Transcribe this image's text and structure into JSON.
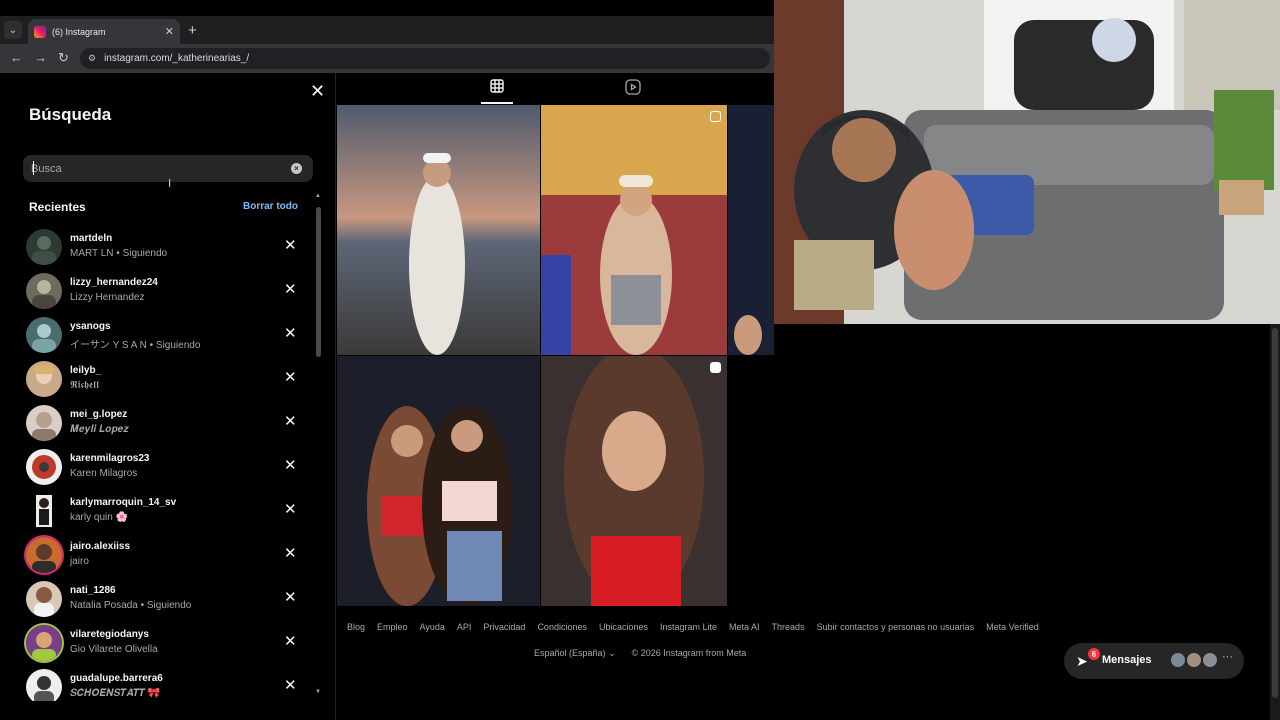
{
  "browser": {
    "tab_title": "(6) Instagram",
    "url": "instagram.com/_katherinearias_/"
  },
  "search_panel": {
    "title": "Búsqueda",
    "placeholder": "Busca",
    "recent_heading": "Recientes",
    "clear_all": "Borrar todo",
    "results": [
      {
        "username": "martdeln",
        "subtitle": "MART LN • Siguiendo"
      },
      {
        "username": "lizzy_hernandez24",
        "subtitle": "Lizzy Hernandez"
      },
      {
        "username": "ysanogs",
        "subtitle": "イーサン Y S A N • Siguiendo"
      },
      {
        "username": "leilyb_",
        "subtitle": "𝕽𝖎𝖈𝖍𝖊𝖑𝖑"
      },
      {
        "username": "mei_g.lopez",
        "subtitle": "𝑴𝒆𝒚𝒍𝒊 𝑳𝒐𝒑𝒆𝒛"
      },
      {
        "username": "karenmilagros23",
        "subtitle": "Karen Milagros"
      },
      {
        "username": "karlymarroquin_14_sv",
        "subtitle": "karly quin 🌸"
      },
      {
        "username": "jairo.alexiiss",
        "subtitle": "jairo"
      },
      {
        "username": "nati_1286",
        "subtitle": "Natalia Posada • Siguiendo"
      },
      {
        "username": "vilaretegiodanys",
        "subtitle": "Gio Vilarete Olivella"
      },
      {
        "username": "guadalupe.barrera6",
        "subtitle": "𝑺𝑪𝑯𝑶𝑬𝑵𝑺𝑻𝑨𝑻𝑻 🎀"
      }
    ]
  },
  "footer": {
    "links": [
      "Blog",
      "Empleo",
      "Ayuda",
      "API",
      "Privacidad",
      "Condiciones",
      "Ubicaciones",
      "Instagram Lite",
      "Meta AI",
      "Threads",
      "Subir contactos y personas no usuarias",
      "Meta Verified"
    ],
    "language": "Español (España)",
    "copyright": "© 2026 Instagram from Meta"
  },
  "messages": {
    "label": "Mensajes",
    "badge": "6"
  },
  "colors": {
    "link_blue": "#83b8f5",
    "badge_red": "#ff3040",
    "panel_bg": "#000000"
  },
  "icons": [
    "close-icon",
    "clear-input-icon",
    "grid-icon",
    "reels-icon",
    "messages-icon"
  ]
}
